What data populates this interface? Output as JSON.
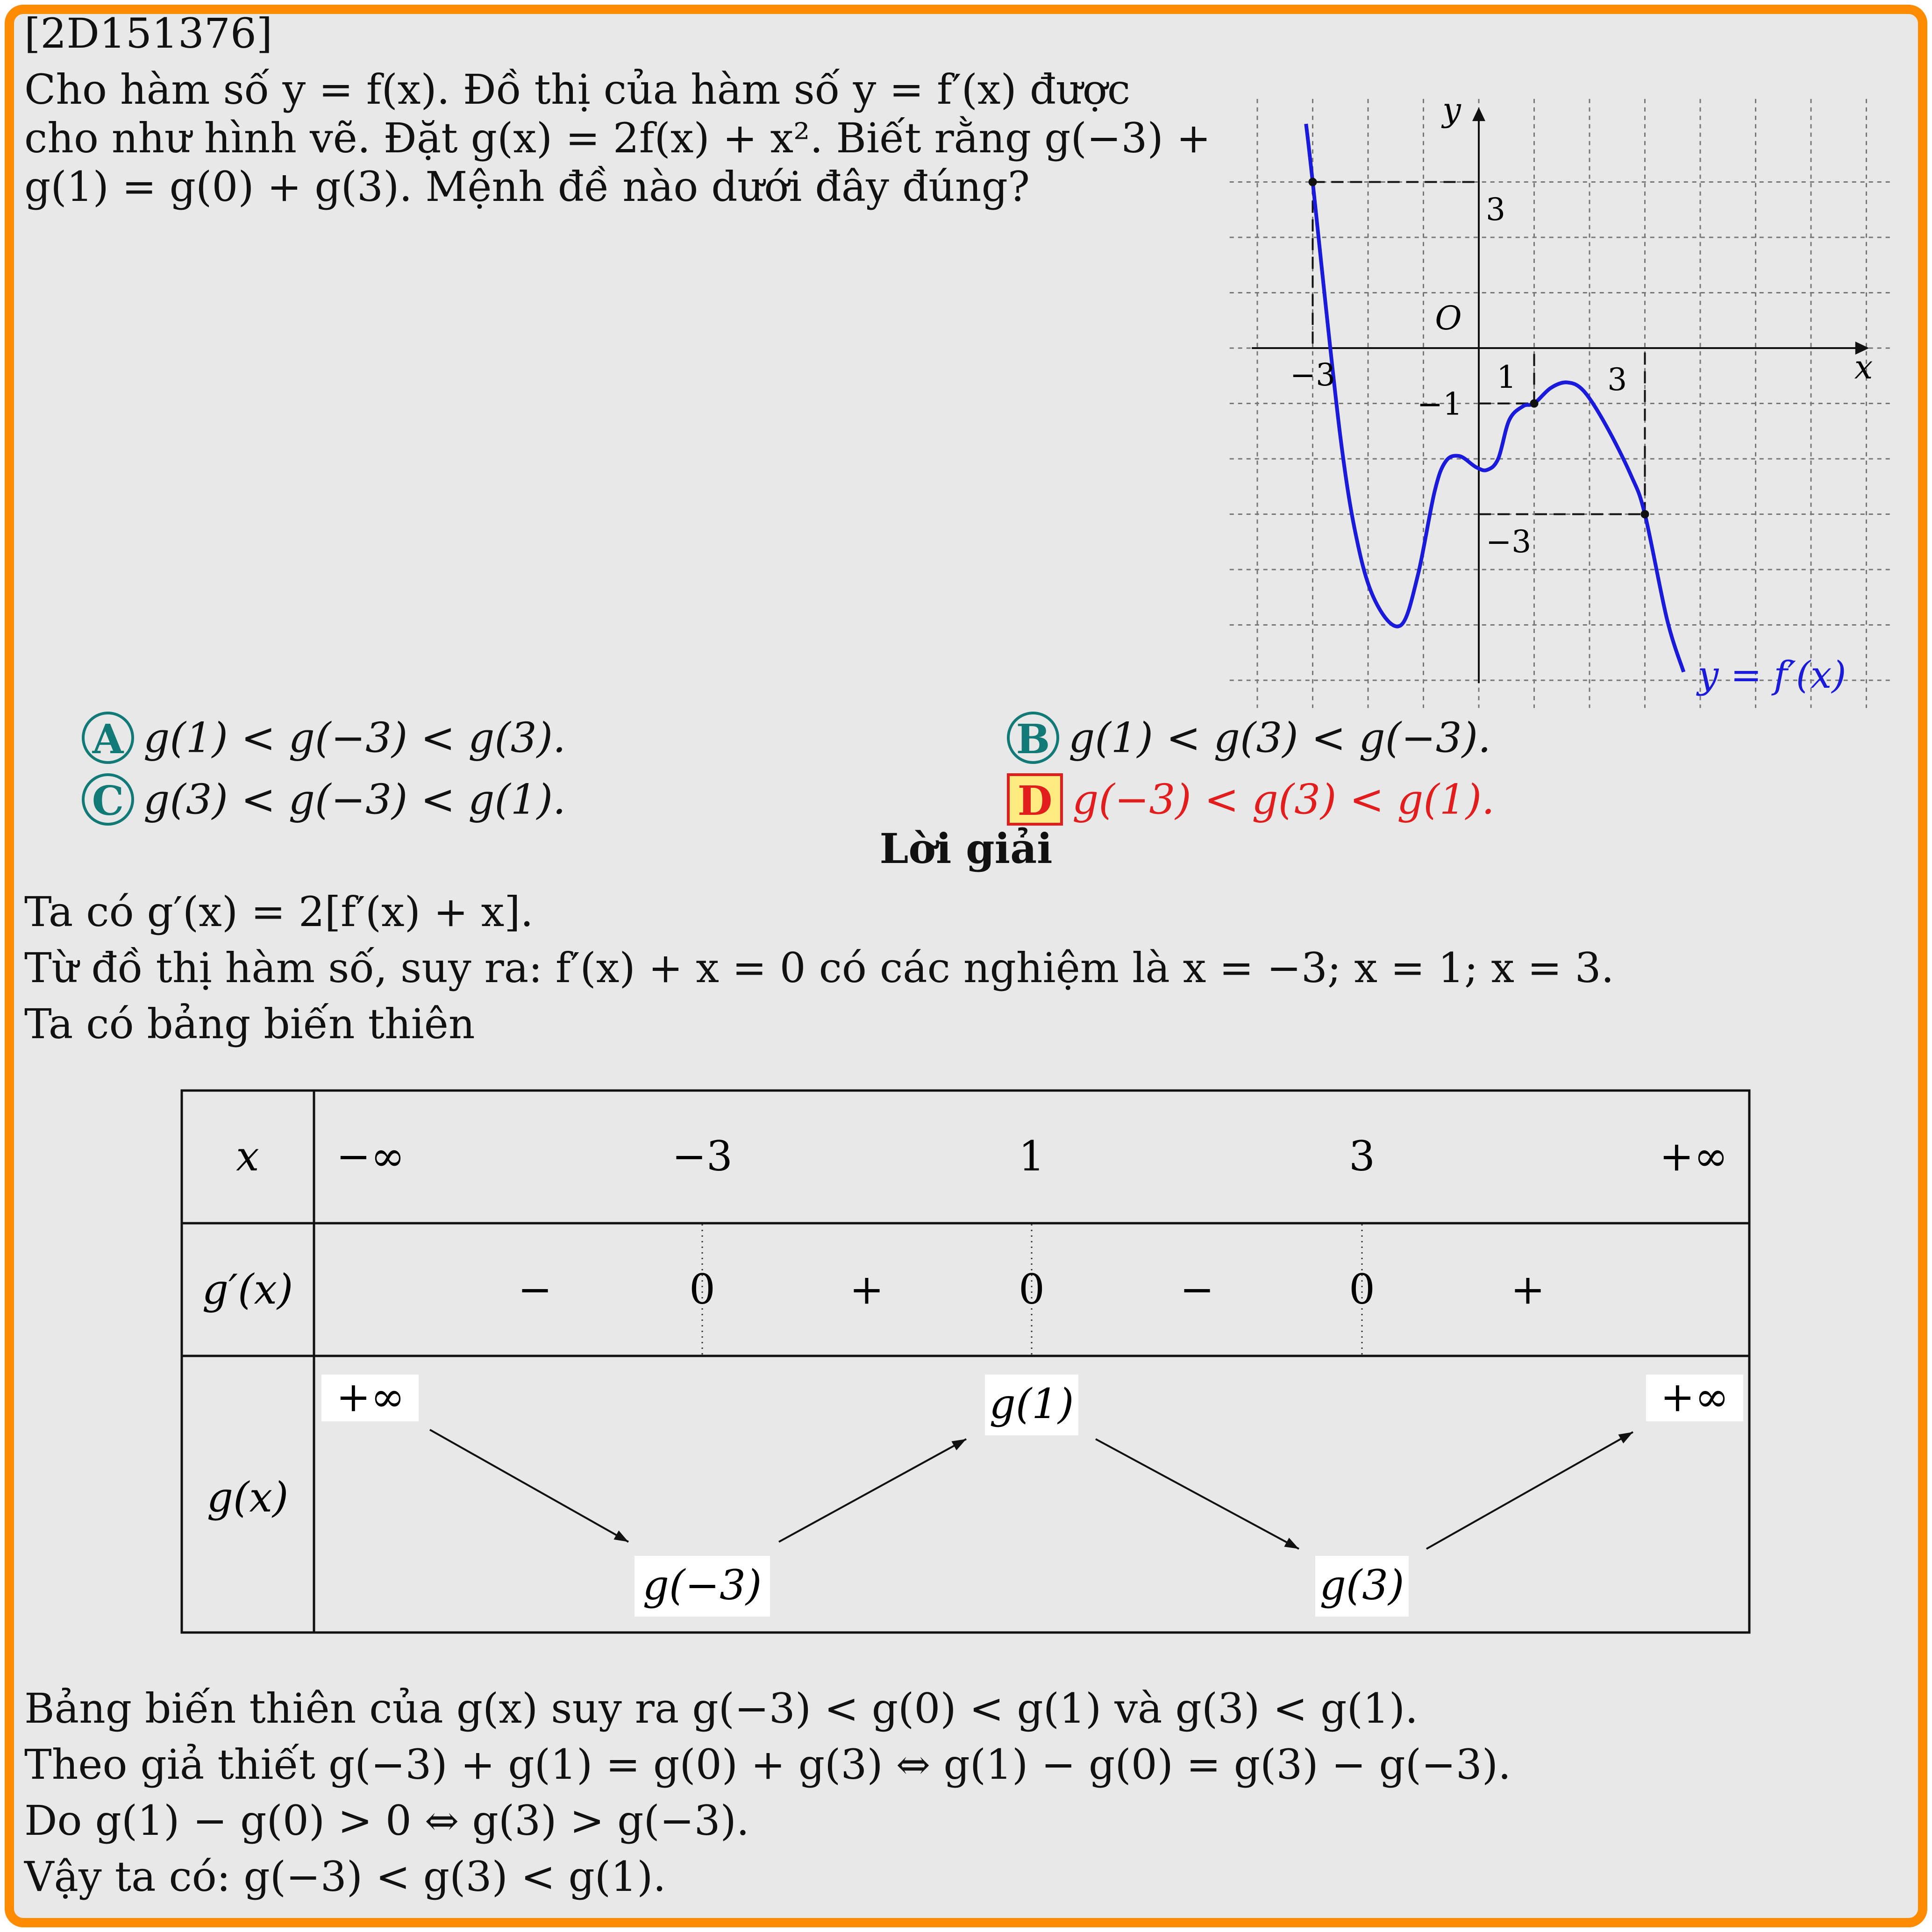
{
  "question_id": "[2D151376]",
  "question_lines": [
    "Cho hàm số y = f(x). Đồ thị của hàm số y = f′(x) được",
    "cho như hình vẽ. Đặt g(x) = 2f(x) + x². Biết rằng g(−3) +",
    "g(1) = g(0) + g(3). Mệnh đề nào dưới đây đúng?"
  ],
  "options": [
    {
      "key": "A",
      "text": "g(1) < g(−3) < g(3).",
      "correct": false
    },
    {
      "key": "B",
      "text": "g(1) < g(3) < g(−3).",
      "correct": false
    },
    {
      "key": "C",
      "text": "g(3) < g(−3) < g(1).",
      "correct": false
    },
    {
      "key": "D",
      "text": "g(−3) < g(3) < g(1).",
      "correct": true
    }
  ],
  "solution_title": "Lời giải",
  "solution_lines_top": [
    "Ta có g′(x) = 2[f′(x) + x].",
    "Từ đồ thị hàm số, suy ra: f′(x) + x = 0 có các nghiệm là x = −3; x = 1; x = 3.",
    "Ta có bảng biến thiên"
  ],
  "solution_lines_bottom": [
    "Bảng biến thiên của g(x) suy ra g(−3) < g(0) < g(1) và g(3) < g(1).",
    "Theo giả thiết g(−3) + g(1) = g(0) + g(3) ⇔ g(1) − g(0) = g(3) − g(−3).",
    "Do g(1) − g(0) > 0 ⇔ g(3) > g(−3).",
    "Vậy ta có: g(−3) < g(3) < g(1)."
  ],
  "graph": {
    "axis_x_label": "x",
    "axis_y_label": "y",
    "origin_label": "O",
    "tick_labels": {
      "x_neg3": "−3",
      "x_1": "1",
      "x_3": "3",
      "y_3": "3",
      "y_neg1": "−1",
      "y_neg3": "−3"
    },
    "curve_label": "y = f′(x)",
    "curve_color": "#1a1adb",
    "marked_points": [
      [
        -3,
        3
      ],
      [
        1,
        -1
      ],
      [
        3,
        -3
      ]
    ]
  },
  "variation_table": {
    "row_labels": {
      "x": "x",
      "gp": "g′(x)",
      "g": "g(x)"
    },
    "x_values": [
      "−∞",
      "−3",
      "1",
      "3",
      "+∞"
    ],
    "sign_values": [
      "−",
      "0",
      "+",
      "0",
      "−",
      "0",
      "+"
    ],
    "g_values": {
      "left": "+∞",
      "min1": "g(−3)",
      "max": "g(1)",
      "min2": "g(3)",
      "right": "+∞"
    }
  },
  "colors": {
    "frame": "#ff8c00",
    "badge": "#117a77",
    "correct": "#e21d1d",
    "correct_bg": "#ffeb80"
  }
}
